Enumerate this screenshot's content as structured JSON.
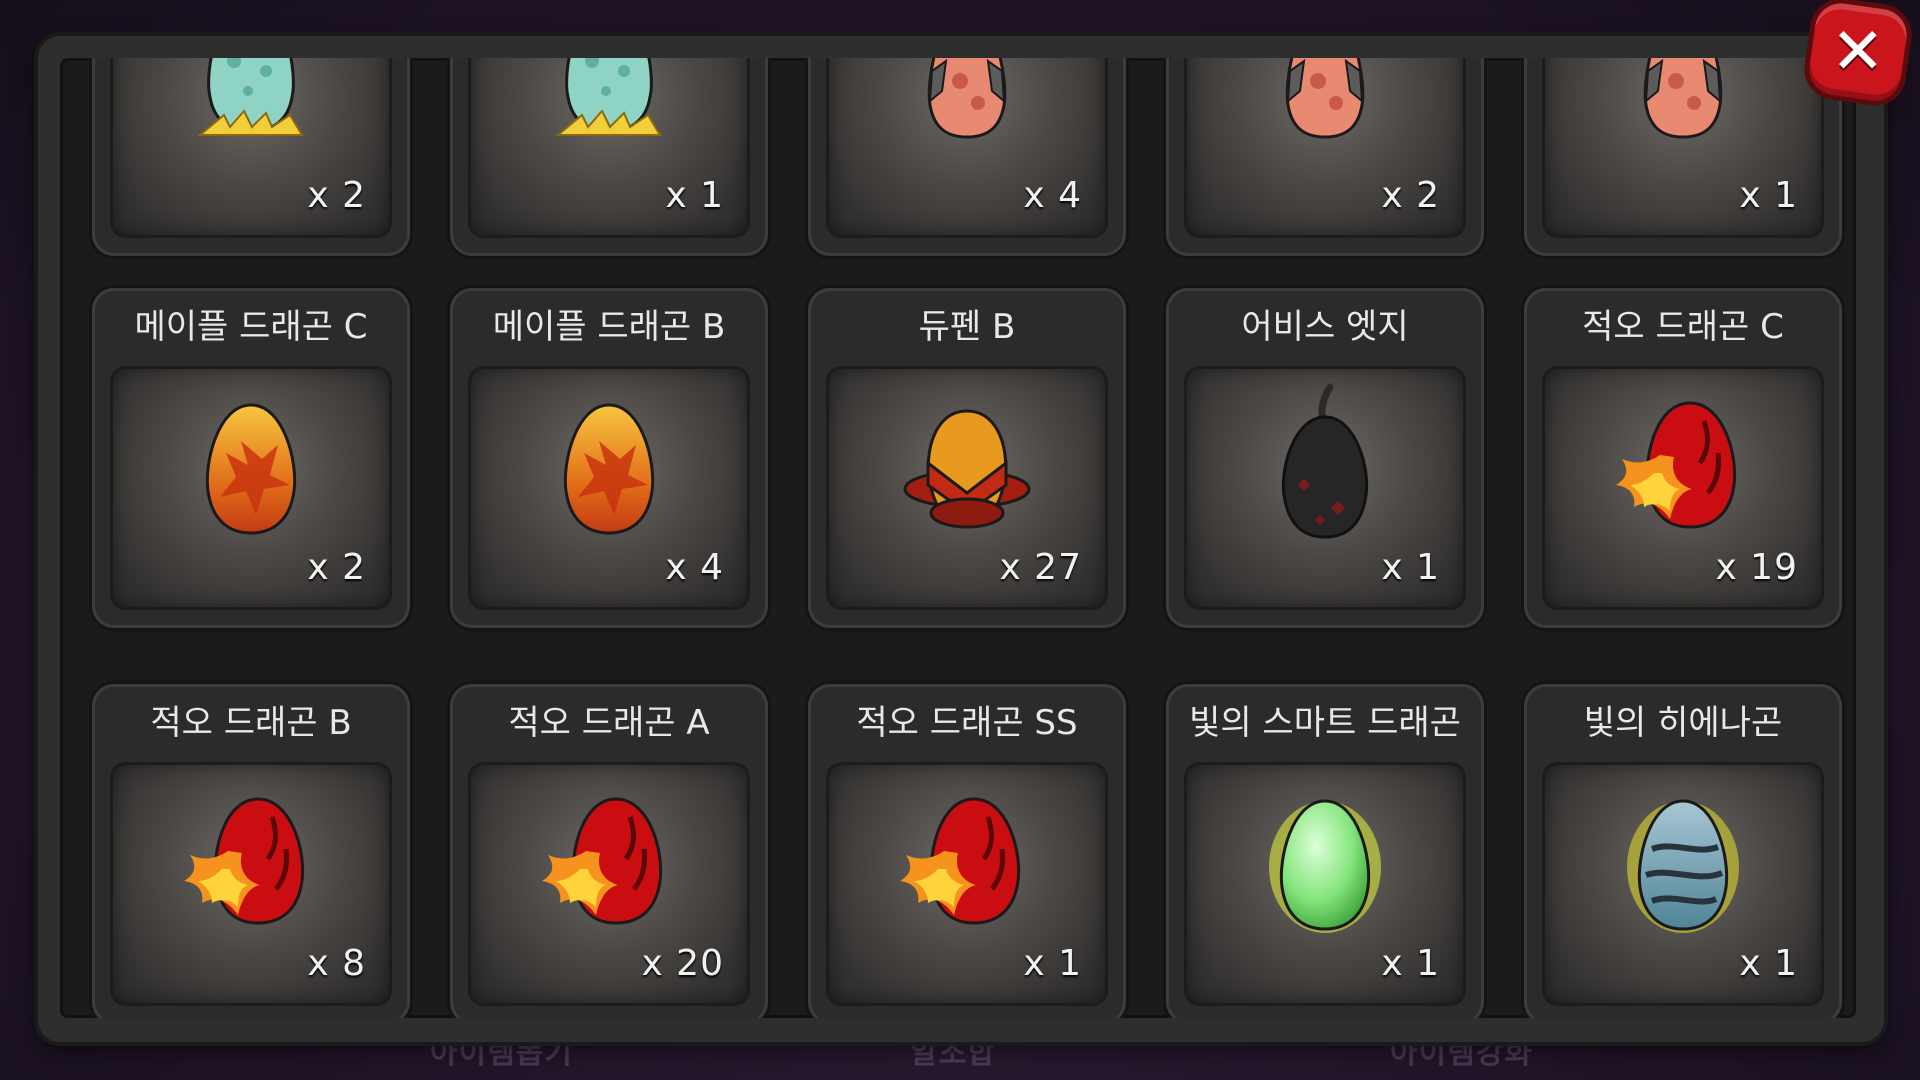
{
  "background_tabs": [
    "아이템뽑기",
    "알조합",
    "아이템강화"
  ],
  "close_button": {
    "label": "✕",
    "icon": "close-icon"
  },
  "rows": [
    [
      {
        "name": "",
        "qty": "x 2",
        "egg": "teal"
      },
      {
        "name": "",
        "qty": "x 1",
        "egg": "teal"
      },
      {
        "name": "",
        "qty": "x 4",
        "egg": "salmon"
      },
      {
        "name": "",
        "qty": "x 2",
        "egg": "salmon"
      },
      {
        "name": "",
        "qty": "x 1",
        "egg": "salmon"
      }
    ],
    [
      {
        "name": "메이플 드래곤 C",
        "qty": "x 2",
        "egg": "maple"
      },
      {
        "name": "메이플 드래곤 B",
        "qty": "x 4",
        "egg": "maple"
      },
      {
        "name": "듀펜 B",
        "qty": "x 27",
        "egg": "dupen"
      },
      {
        "name": "어비스 엣지",
        "qty": "x 1",
        "egg": "abyss"
      },
      {
        "name": "적오 드래곤 C",
        "qty": "x 19",
        "egg": "fire"
      }
    ],
    [
      {
        "name": "적오 드래곤 B",
        "qty": "x 8",
        "egg": "fire"
      },
      {
        "name": "적오 드래곤 A",
        "qty": "x 20",
        "egg": "fire"
      },
      {
        "name": "적오 드래곤 SS",
        "qty": "x 1",
        "egg": "fire"
      },
      {
        "name": "빛의 스마트 드래곤",
        "qty": "x 1",
        "egg": "green"
      },
      {
        "name": "빛의 히에나곤",
        "qty": "x 1",
        "egg": "blue"
      }
    ]
  ]
}
